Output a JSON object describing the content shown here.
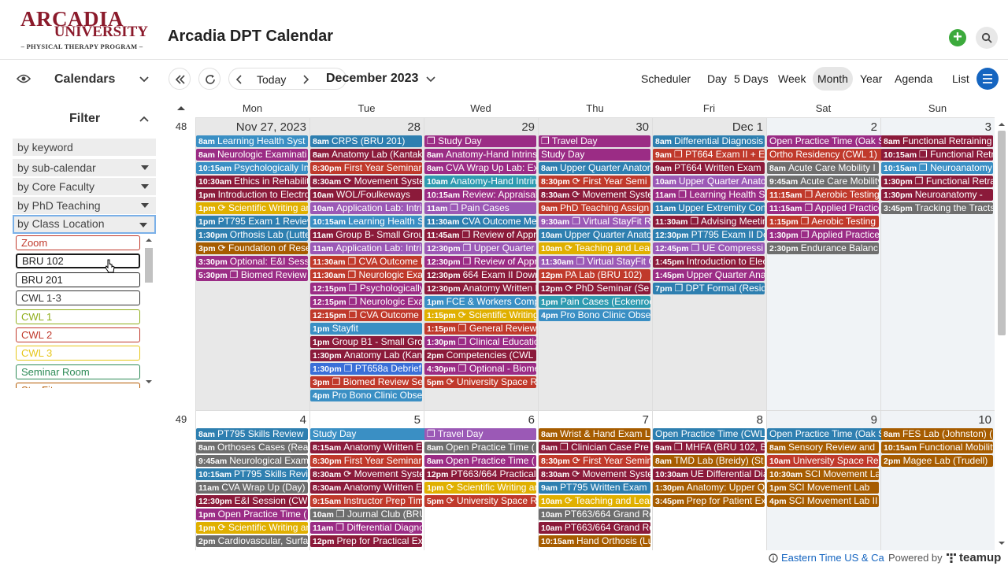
{
  "logo": {
    "line1": "ARCADIA",
    "line2": "UNIVERSITY",
    "line3": "– PHYSICAL THERAPY PROGRAM –"
  },
  "app_title": "Arcadia DPT Calendar",
  "sidebar": {
    "calendars_label": "Calendars",
    "filter_label": "Filter",
    "filters": [
      "by keyword",
      "by sub-calendar",
      "by Core Faculty",
      "by PhD Teaching",
      "by Class Location"
    ],
    "locations": [
      {
        "label": "Zoom",
        "color": "#c0392b"
      },
      {
        "label": "BRU 102",
        "color": "#222222"
      },
      {
        "label": "BRU 201",
        "color": "#222222"
      },
      {
        "label": "CWL 1-3",
        "color": "#333333"
      },
      {
        "label": "CWL 1",
        "color": "#8fae1b"
      },
      {
        "label": "CWL 2",
        "color": "#c0392b"
      },
      {
        "label": "CWL 3",
        "color": "#e6c619"
      },
      {
        "label": "Seminar Room",
        "color": "#2e8b57"
      },
      {
        "label": "StayFit",
        "color": "#b35900"
      }
    ]
  },
  "toolbar": {
    "today": "Today",
    "month_label": "December 2023",
    "views": [
      "Scheduler",
      "Day",
      "5 Days",
      "Week",
      "Month",
      "Year",
      "Agenda",
      "List"
    ],
    "selected_view": "Month"
  },
  "weekdays": [
    "Mon",
    "Tue",
    "Wed",
    "Thu",
    "Fri",
    "Sat",
    "Sun"
  ],
  "weeks": [
    {
      "num": "48",
      "days": [
        "Nov 27, 2023",
        "28",
        "29",
        "30",
        "Dec 1",
        "2",
        "3"
      ],
      "events": [
        [
          [
            "8am",
            "Learning Health Syst",
            "#3a8fc4"
          ],
          [
            "8am",
            "Neurologic Examinati",
            "#9b2c85"
          ],
          [
            "10:15am",
            "Psychologically In",
            "#3a8fc4"
          ],
          [
            "10:30am",
            "Ethics in Rehabilit",
            "#8b1a3a"
          ],
          [
            "1pm",
            "Introduction to Electro",
            "#8b1a3a"
          ],
          [
            "1pm",
            "⟳ Scientific Writing an",
            "#e0b000"
          ],
          [
            "1pm",
            "PT795 Exam 1 Review",
            "#2e7fb0"
          ],
          [
            "1:30pm",
            "Orthosis Lab (Lutte",
            "#2e7fb0"
          ],
          [
            "3pm",
            "⟳ Foundation of Rese",
            "#a65c00"
          ],
          [
            "3:30pm",
            "Optional: E&I Sess",
            "#9b2c85"
          ],
          [
            "5:30pm",
            "❐ Biomed Review",
            "#9b2c85"
          ]
        ],
        [
          [
            "8am",
            "CRPS (BRU 201)",
            "#2e7fb0"
          ],
          [
            "8am",
            "Anatomy Lab (Kantak",
            "#8b1a3a"
          ],
          [
            "8:30pm",
            "First Year Seminar",
            "#c0392b"
          ],
          [
            "8:30am",
            "⟳ Movement Syste",
            "#8b1a3a"
          ],
          [
            "10am",
            "WOL/Foulkeways",
            "#8b1a3a"
          ],
          [
            "10am",
            "Application Lab: Intri",
            "#9b59b6"
          ],
          [
            "10:15am",
            "Learning Health S",
            "#3a8fc4"
          ],
          [
            "11am",
            "Group B- Small Grou",
            "#8b1a3a"
          ],
          [
            "11am",
            "Application Lab: Intri",
            "#9b59b6"
          ],
          [
            "11:30am",
            "❐ CVA Outcome M",
            "#c0392b"
          ],
          [
            "11:30am",
            "❐ Neurologic Exa",
            "#c0392b"
          ],
          [
            "12:15pm",
            "❐ Psychologically",
            "#9b2c85"
          ],
          [
            "12:15pm",
            "❐ Neurologic Exa",
            "#9b2c85"
          ],
          [
            "12:15pm",
            "❐ CVA Outcome",
            "#c0392b"
          ],
          [
            "1pm",
            "Stayfit",
            "#3a8fc4"
          ],
          [
            "1pm",
            "Group B1 - Small Gro",
            "#8b1a3a"
          ],
          [
            "1:30pm",
            "Anatomy Lab (Kan",
            "#8b1a3a"
          ],
          [
            "1:30pm",
            "❐ PT658a Debrief",
            "#3a6fd8"
          ],
          [
            "3pm",
            "❐ Biomed Review Se",
            "#c0392b"
          ],
          [
            "4pm",
            "Pro Bono Clinic Obse",
            "#3a8fc4"
          ]
        ],
        [
          [
            "",
            "❐ Study Day",
            "#9b2c85"
          ],
          [
            "8am",
            "Anatomy-Hand Intrins",
            "#9b2c85"
          ],
          [
            "8am",
            "CVA Wrap Up Lab: Ex",
            "#9b2c85"
          ],
          [
            "10am",
            "Anatomy-Hand Intrin",
            "#2e9ab0"
          ],
          [
            "10:15am",
            "Review: Appraisal",
            "#9b2c85"
          ],
          [
            "11am",
            "❐ Pain Cases",
            "#9b59b6"
          ],
          [
            "11:30am",
            "CVA Outcome Me",
            "#2e7fb0"
          ],
          [
            "11:45am",
            "❐ Review of Appr",
            "#8b1a3a"
          ],
          [
            "12:30pm",
            "❐ Upper Quarter",
            "#9b59b6"
          ],
          [
            "12:30pm",
            "❐ Review of Appr",
            "#9b2c85"
          ],
          [
            "12:30pm",
            "664 Exam II Down",
            "#8b1a3a"
          ],
          [
            "12:30pm",
            "Anatomy Written E",
            "#8b1a3a"
          ],
          [
            "1pm",
            "FCE & Workers Comp",
            "#3a8fc4"
          ],
          [
            "1:15pm",
            "⟳ Scientific Writing an",
            "#e0b000"
          ],
          [
            "1:15pm",
            "❐ General Review",
            "#c0392b"
          ],
          [
            "1:30pm",
            "❐ Clinical Educatio",
            "#9b2c85"
          ],
          [
            "2pm",
            "Competencies (CWL",
            "#8b1a3a"
          ],
          [
            "4:30pm",
            "❐ Optional - Biome",
            "#9b2c85"
          ],
          [
            "5pm",
            "⟳ University Space R",
            "#c0392b"
          ]
        ],
        [
          [
            "",
            "❐ Travel Day",
            "#9b2c85"
          ],
          [
            "",
            "Study Day",
            "#9b2c85"
          ],
          [
            "8am",
            "Upper Quarter Anatom",
            "#2e7fb0"
          ],
          [
            "8:30pm",
            "⟳ First Year Semi",
            "#c0392b"
          ],
          [
            "8:30am",
            "⟳ Movement Syste",
            "#8b1a3a"
          ],
          [
            "9am",
            "PhD Teaching Assign",
            "#c0392b"
          ],
          [
            "9:30am",
            "❐ Virtual StayFit R",
            "#9b59b6"
          ],
          [
            "10am",
            "Upper Quarter Anato",
            "#2e7fb0"
          ],
          [
            "10am",
            "⟳ Teaching and Lear",
            "#e0b000"
          ],
          [
            "11:30am",
            "❐ Virtual StayFit C",
            "#9b59b6"
          ],
          [
            "12pm",
            "PA Lab (BRU 102)",
            "#c0392b"
          ],
          [
            "12pm",
            "⟳ PhD Seminar (Se",
            "#8b1a3a"
          ],
          [
            "1pm",
            "Pain Cases (Eckenroc",
            "#2e9ab0"
          ],
          [
            "4pm",
            "Pro Bono Clinic Obse",
            "#3a8fc4"
          ]
        ],
        [
          [
            "8am",
            "Differential Diagnosis",
            "#2e7fb0"
          ],
          [
            "9am",
            "❐ PT664 Exam II + E",
            "#c0392b"
          ],
          [
            "9am",
            "PT664 Written Exam",
            "#8b1a3a"
          ],
          [
            "10am",
            "Upper Quarter Anato",
            "#9b59b6"
          ],
          [
            "11am",
            "❐ Learning Health S",
            "#9b2c85"
          ],
          [
            "11am",
            "Upper Extremity Con",
            "#2e7fb0"
          ],
          [
            "11:30am",
            "❐ Advising Meetin",
            "#8b1a3a"
          ],
          [
            "12:30pm",
            "PT795 Exam II Do",
            "#2e7fb0"
          ],
          [
            "12:45pm",
            "❐ UE Compressi",
            "#9b59b6"
          ],
          [
            "1:45pm",
            "Introduction to Elec",
            "#8b1a3a"
          ],
          [
            "1:45pm",
            "Upper Quarter Ana",
            "#9b2c85"
          ],
          [
            "7pm",
            "❐ DPT Formal (Resid",
            "#2e7fb0"
          ]
        ],
        [
          [
            "",
            "Open Practice Time (Oak Summit)",
            "#9b2c85"
          ],
          [
            "",
            "Ortho Residency (CWL 1)",
            "#c0392b"
          ],
          [
            "8am",
            "Acute Care Mobility I",
            "#6e6e6e"
          ],
          [
            "9:45am",
            "Acute Care Mobility",
            "#6e6e6e"
          ],
          [
            "11:15am",
            "❐ Aerobic Testing",
            "#c0392b"
          ],
          [
            "11:15am",
            "❐ Applied Practice",
            "#9b2c85"
          ],
          [
            "1:15pm",
            "❐ Aerobic Testing",
            "#c0392b"
          ],
          [
            "1:30pm",
            "❐ Applied Practice",
            "#9b2c85"
          ],
          [
            "2:30pm",
            "Endurance Balanc",
            "#6e6e6e"
          ]
        ],
        [
          [
            "8am",
            "Functional Retraining",
            "#8b1a3a"
          ],
          [
            "10:15am",
            "❐ Functional Retr",
            "#8b1a3a"
          ],
          [
            "10:15am",
            "❐ Neuroanatomy",
            "#3a8fc4"
          ],
          [
            "1:30pm",
            "❐ Functional Retra",
            "#8b1a3a"
          ],
          [
            "1:30pm",
            "Neuroanatomy -",
            "#8b1a3a"
          ],
          [
            "3:45pm",
            "Tracking the Tracts",
            "#6e6e6e"
          ]
        ]
      ]
    },
    {
      "num": "49",
      "days": [
        "4",
        "5",
        "6",
        "7",
        "8",
        "9",
        "10"
      ],
      "events": [
        [
          [
            "8am",
            "PT795 Skills Review",
            "#2e7fb0"
          ],
          [
            "8am",
            "Orthoses Cases (Rea",
            "#6e6e6e"
          ],
          [
            "9:45am",
            "Neurological Exam",
            "#6e6e6e"
          ],
          [
            "10:15am",
            "PT795 Skills Revie",
            "#2e7fb0"
          ],
          [
            "11am",
            "CVA Wrap Up (Day)",
            "#6e6e6e"
          ],
          [
            "12:30pm",
            "E&I Session (CWI",
            "#8b1a3a"
          ],
          [
            "1pm",
            "Open Practice Time (",
            "#9b2c85"
          ],
          [
            "1pm",
            "⟳ Scientific Writing an",
            "#e0b000"
          ],
          [
            "2pm",
            "Cardiovascular, Surfa",
            "#6e6e6e"
          ]
        ],
        [
          [
            "",
            "Study Day",
            "#3a8fc4"
          ],
          [
            "8:15am",
            "Anatomy Written E",
            "#8b1a3a"
          ],
          [
            "8:30pm",
            "First Year Seminar",
            "#c0392b"
          ],
          [
            "8:30am",
            "⟳ Movement Syste",
            "#8b1a3a"
          ],
          [
            "8:30am",
            "Anatomy Written E",
            "#8b1a3a"
          ],
          [
            "9:15am",
            "Instructor Prep Tim",
            "#c0392b"
          ],
          [
            "10am",
            "❐ Journal Club (BRU",
            "#6e6e6e"
          ],
          [
            "11am",
            "❐ Differential Diagno",
            "#9b2c85"
          ],
          [
            "12pm",
            "Prep for Practical Ex",
            "#8b1a3a"
          ]
        ],
        [
          [
            "",
            "❐ Travel Day",
            "#9b59b6"
          ],
          [
            "8am",
            "Open Practice Time (",
            "#6e6e6e"
          ],
          [
            "8am",
            "Open Practice Time (",
            "#9b2c85"
          ],
          [
            "12pm",
            "PT663/664 Practical",
            "#8b1a3a"
          ],
          [
            "1pm",
            "⟳ Scientific Writing an",
            "#e0b000"
          ],
          [
            "5pm",
            "⟳ University Space R",
            "#c0392b"
          ]
        ],
        [
          [
            "8am",
            "Wrist & Hand Exam L",
            "#a65c00"
          ],
          [
            "8am",
            "❐ Clinician Case Pre",
            "#8b1a3a"
          ],
          [
            "8:30pm",
            "⟳ First Year Semin",
            "#c0392b"
          ],
          [
            "8:30am",
            "⟳ Movement Syste",
            "#8b1a3a"
          ],
          [
            "9am",
            "PT795 Written Exam",
            "#2e7fb0"
          ],
          [
            "10am",
            "⟳ Teaching and Lear",
            "#e0b000"
          ],
          [
            "10am",
            "PT663/664 Grand Ro",
            "#6e6e6e"
          ],
          [
            "10am",
            "PT663/664 Grand Ro",
            "#8b1a3a"
          ],
          [
            "10:15am",
            "Hand Orthosis (Lu",
            "#a65c00"
          ]
        ],
        [
          [
            "",
            "Open Practice Time (CWL",
            "#2e7fb0"
          ],
          [
            "9am",
            "❐ MHFA (BRU 102, B",
            "#8b1a3a"
          ],
          [
            "8am",
            "TMD Lab (Breidy) (St",
            "#a65c00"
          ],
          [
            "10:30am",
            "UE Differential Dia",
            "#8b1a3a"
          ],
          [
            "1:30pm",
            "Anatomy: Upper Q",
            "#a65c00"
          ],
          [
            "3:45pm",
            "Prep for Patient Ex",
            "#a65c00"
          ]
        ],
        [
          [
            "",
            "Open Practice Time (Oak Summit)",
            "#2e7fb0"
          ],
          [
            "8am",
            "Sensory Review and",
            "#a65c00"
          ],
          [
            "10am",
            "University Space Re",
            "#c0392b"
          ],
          [
            "10:30am",
            "SCI Movement La",
            "#a65c00"
          ],
          [
            "1pm",
            "SCI Movement Lab",
            "#a65c00"
          ],
          [
            "4pm",
            "SCI Movement Lab II",
            "#a65c00"
          ]
        ],
        [
          [
            "8am",
            "FES Lab (Johnston) (",
            "#a65c00"
          ],
          [
            "10:15am",
            "Functional Mobility",
            "#a65c00"
          ],
          [
            "2pm",
            "Magee Lab (Trudell)",
            "#a65c00"
          ]
        ]
      ]
    }
  ],
  "footer": {
    "timezone": "Eastern Time US & Ca",
    "powered": "Powered by",
    "brand": "teamup"
  }
}
